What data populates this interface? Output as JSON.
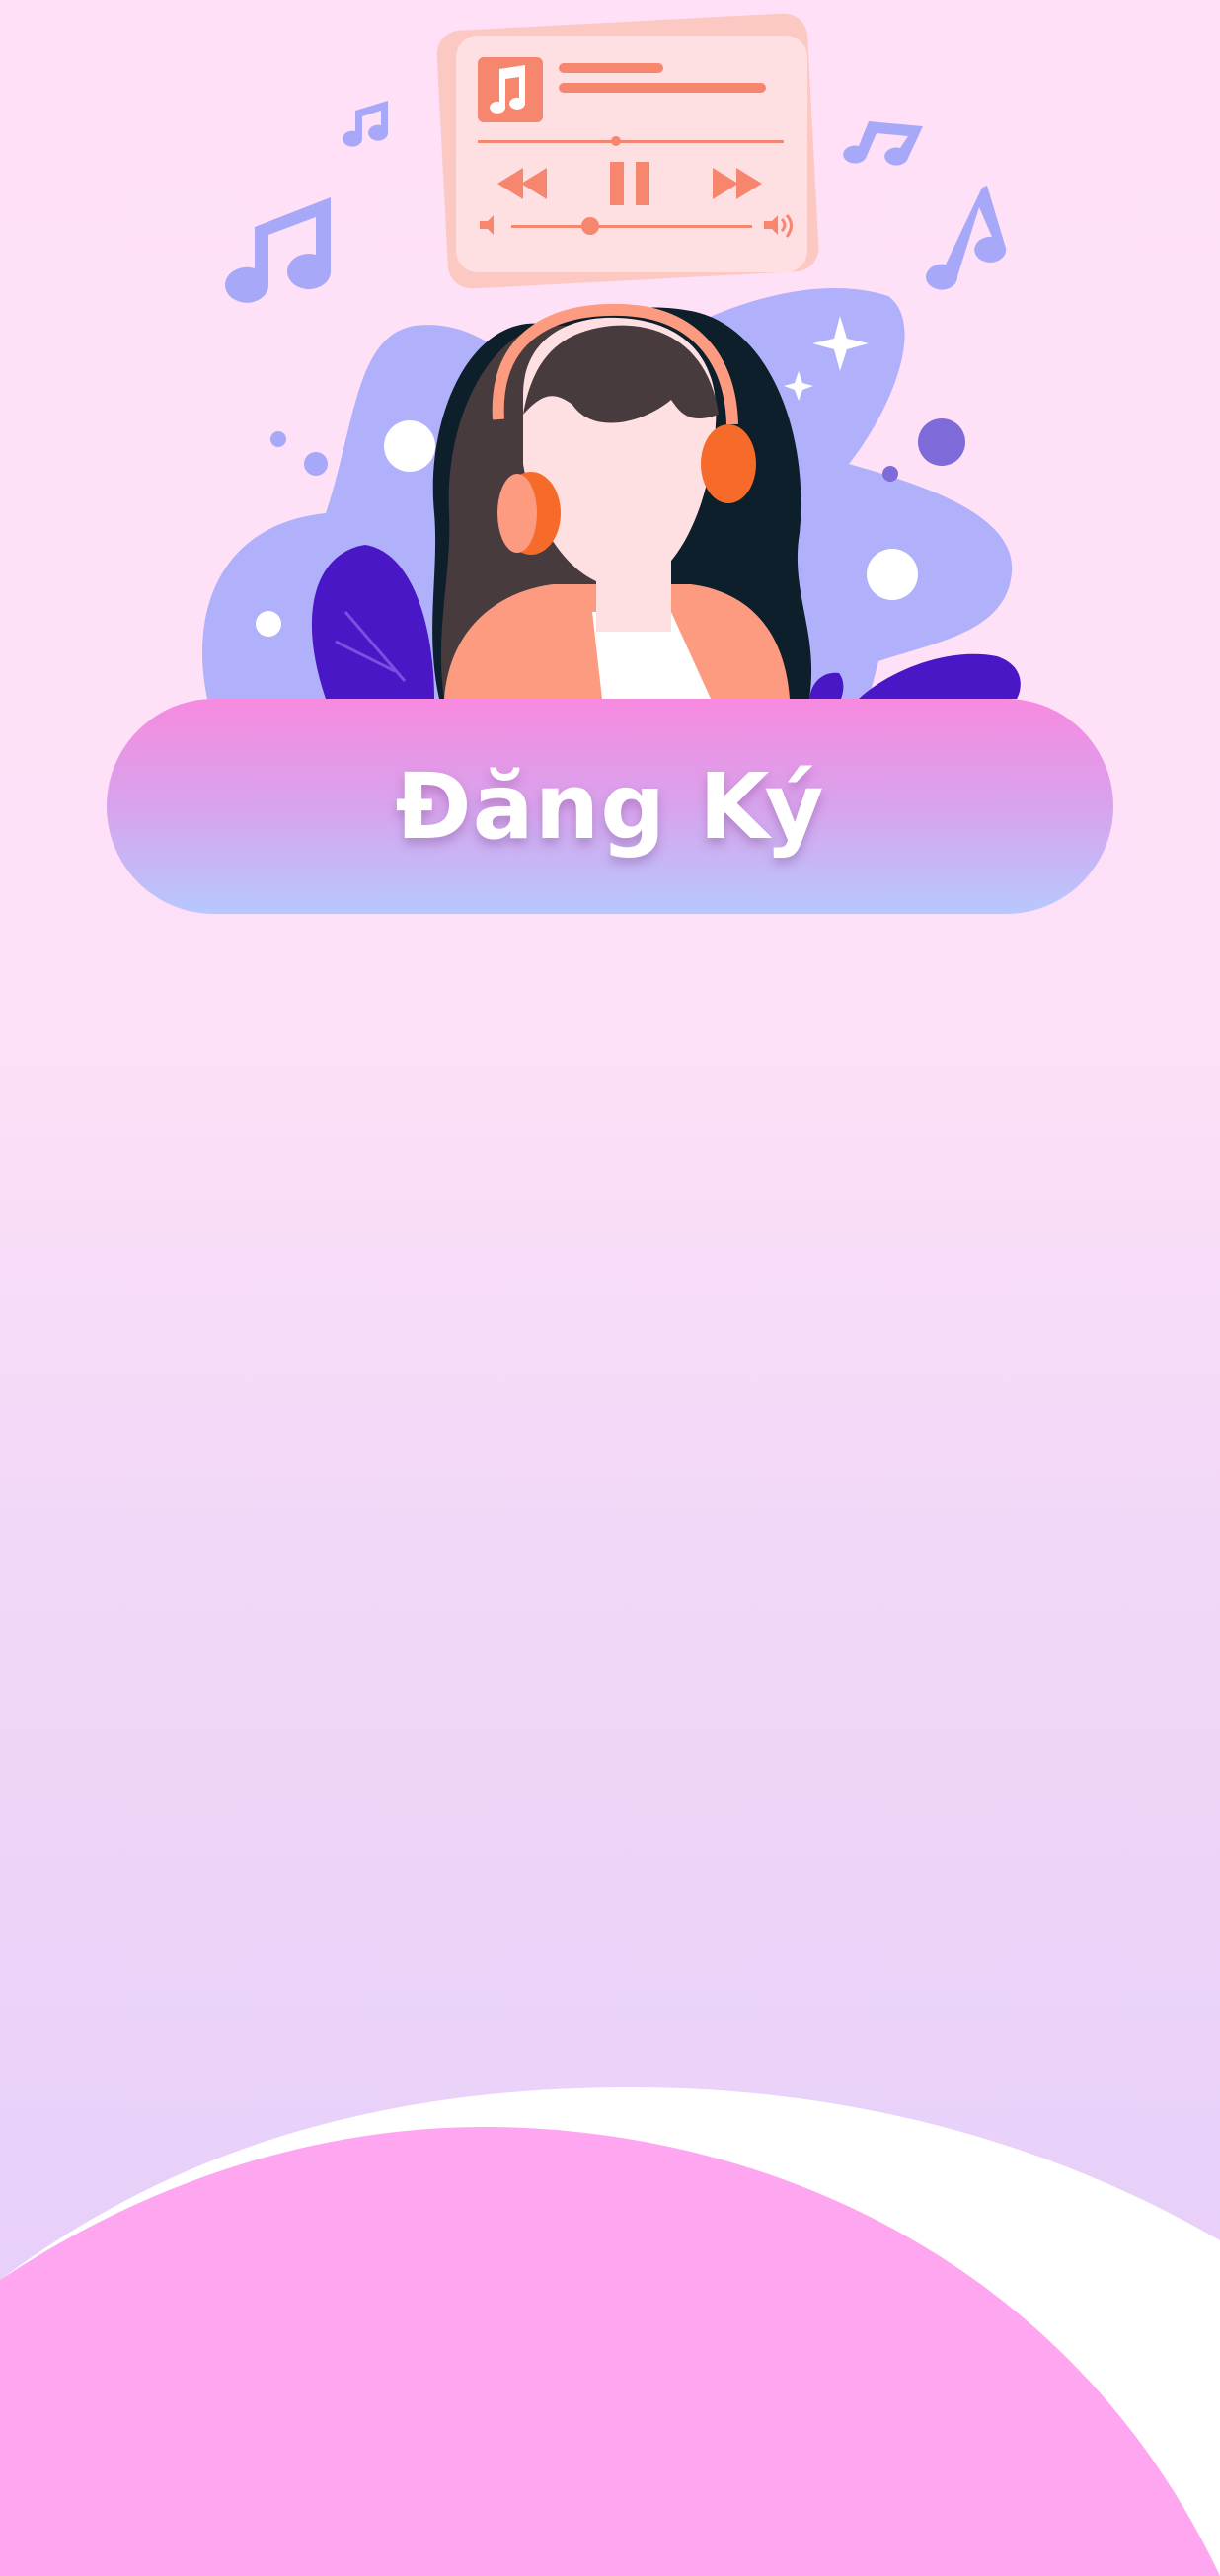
{
  "signup": {
    "label": "Đăng Ký"
  },
  "icons": {
    "music_notes": "music-note-icon",
    "player_card": "music-player-icon",
    "headphones": "headphones-icon"
  },
  "colors": {
    "background_top": "#ffe0f7",
    "background_bottom": "#e3cdfa",
    "button_top": "#f78ae0",
    "button_bottom": "#b7c8fe",
    "blob": "#b0b0fb",
    "accent_orange": "#f7866f",
    "bottom_wave": "#fea6f0"
  }
}
